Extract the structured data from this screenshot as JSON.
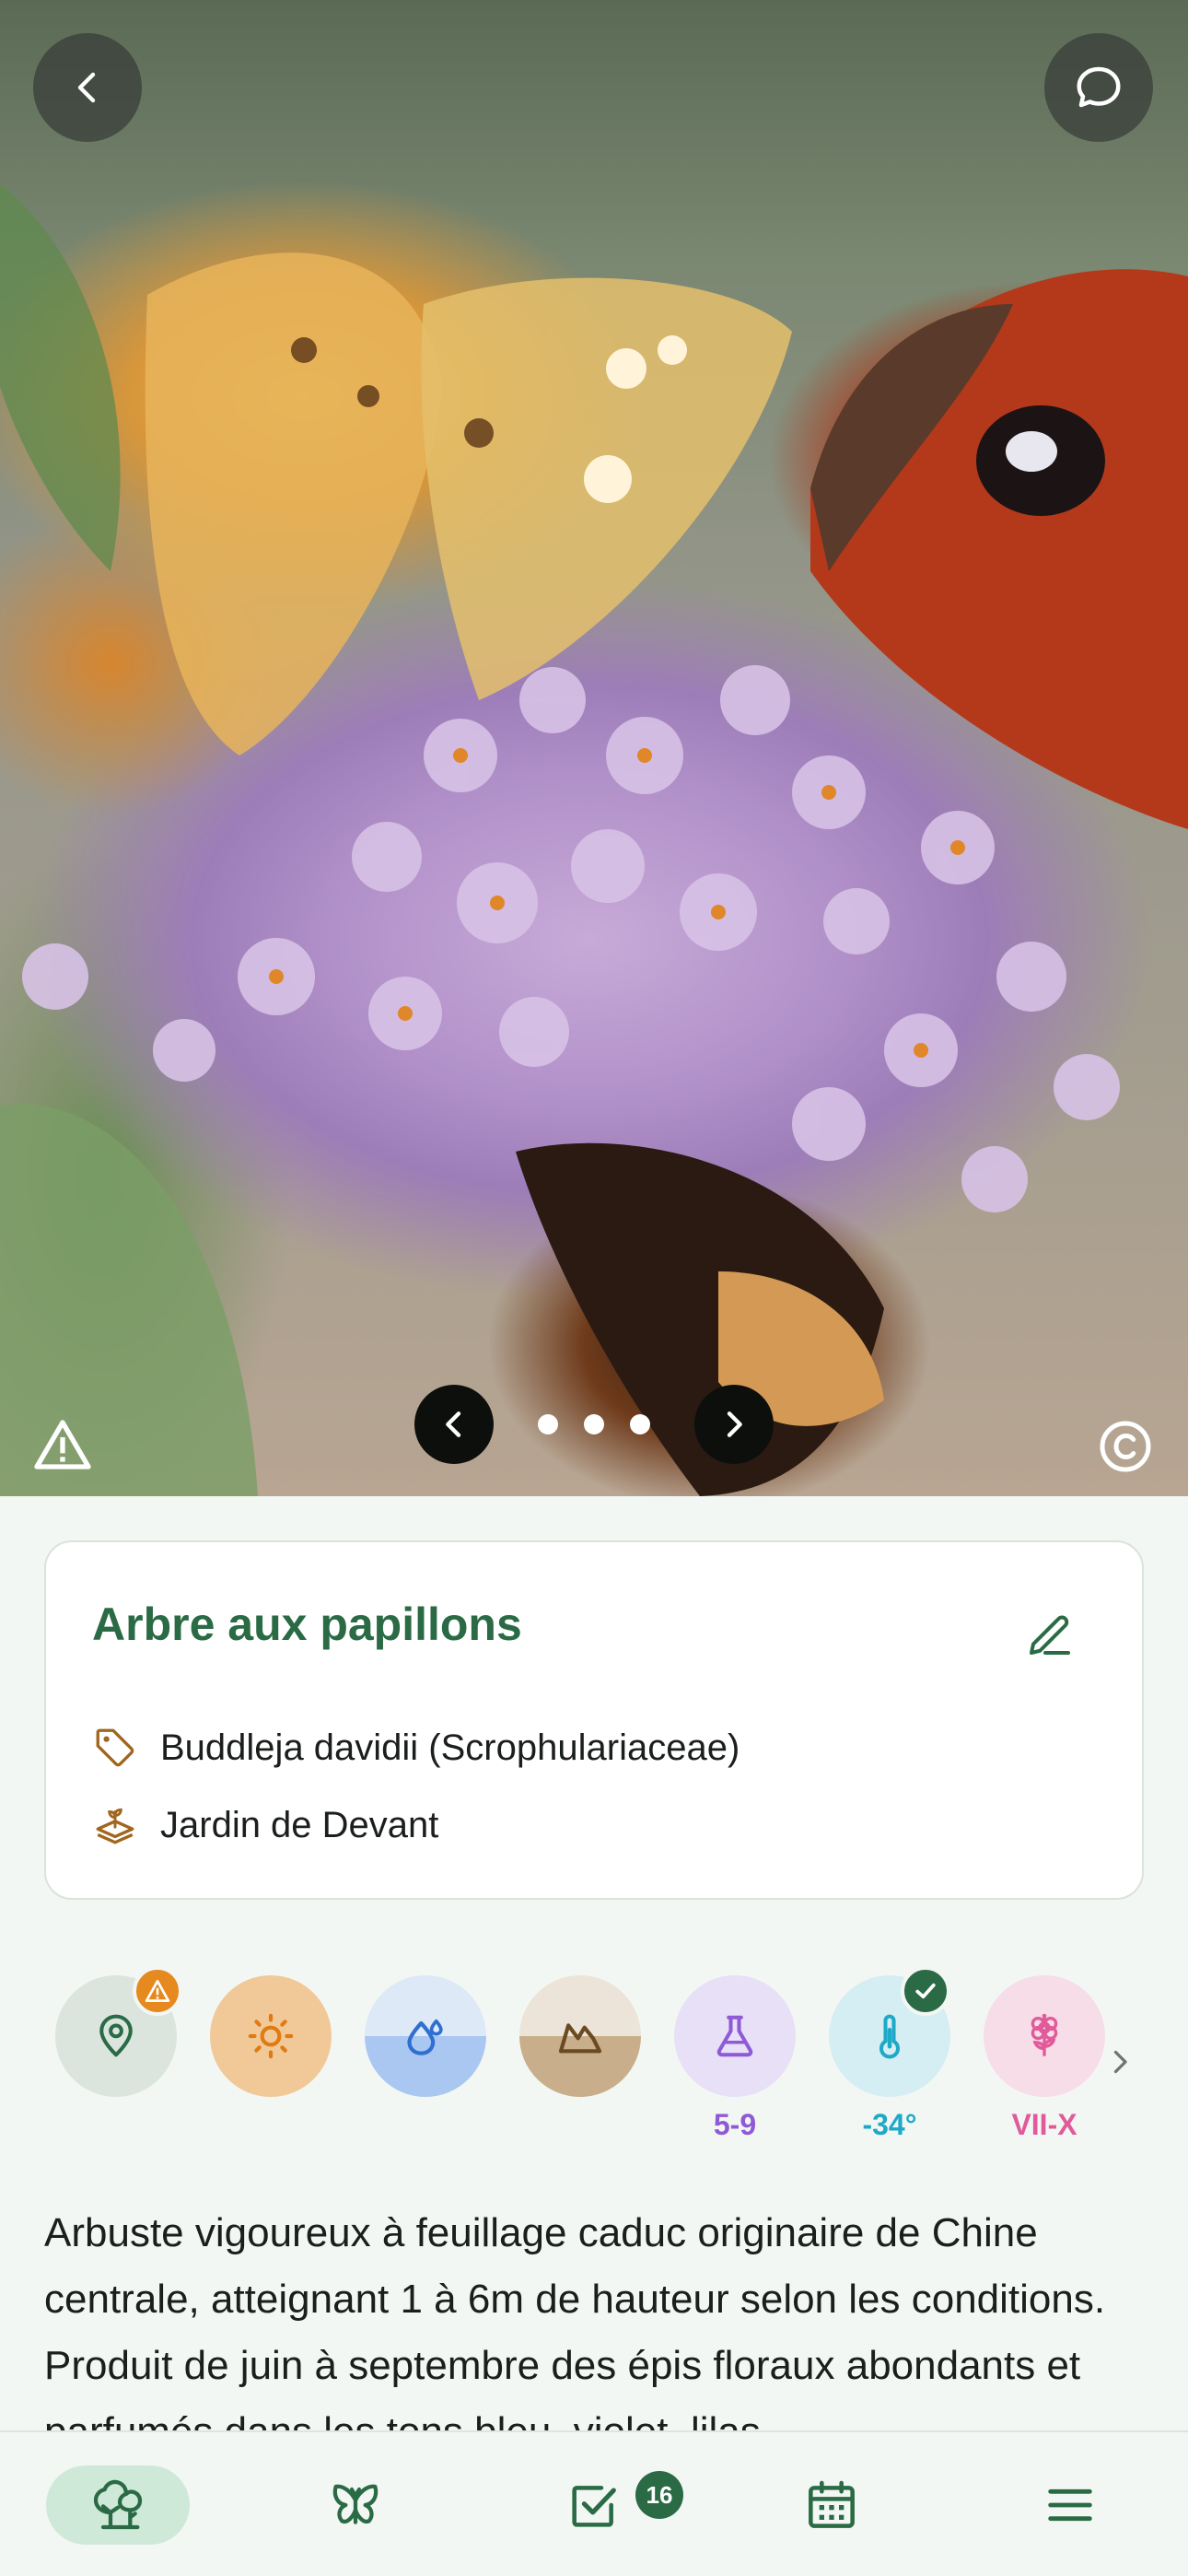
{
  "hero": {
    "photo_subject": "Butterflies on a purple buddleja flower spike",
    "page_count": 3,
    "current_page": 1
  },
  "card": {
    "title": "Arbre aux papillons",
    "scientific_name": "Buddleja davidii (Scrophulariaceae)",
    "location": "Jardin de Devant"
  },
  "chips": [
    {
      "icon": "location-pin-icon",
      "label": "",
      "bg": "#dbe5de",
      "badge": "warning",
      "color": "#2a6b45"
    },
    {
      "icon": "sun-icon",
      "label": "",
      "bg": "#f1c999",
      "color": "#e07a12"
    },
    {
      "icon": "water-drop-icon",
      "label": "",
      "bg": "#b9d3f3",
      "color": "#2f6fd0"
    },
    {
      "icon": "soil-icon",
      "label": "",
      "bg": "#d3bfa4",
      "color": "#6b4a22"
    },
    {
      "icon": "flask-icon",
      "label": "5-9",
      "bg": "#e7e0f7",
      "color": "#8f5ad6"
    },
    {
      "icon": "thermometer-icon",
      "label": "-34°",
      "bg": "#d5eef3",
      "badge": "check",
      "color": "#1da9c7"
    },
    {
      "icon": "flower-icon",
      "label": "VII-X",
      "bg": "#f6dde8",
      "color": "#e15a9a"
    }
  ],
  "description": "Arbuste vigoureux à feuillage caduc originaire de Chine centrale, atteignant 1 à 6m de hauteur selon les conditions. Produit de juin à septembre des épis floraux abondants et parfumés dans les tons bleu, violet, lilas",
  "bottom_nav": {
    "items": [
      "plants",
      "wildlife",
      "tasks",
      "calendar",
      "menu"
    ],
    "tasks_badge": "16"
  },
  "colors": {
    "accent": "#2a6b45",
    "background": "#f3f7f4"
  }
}
